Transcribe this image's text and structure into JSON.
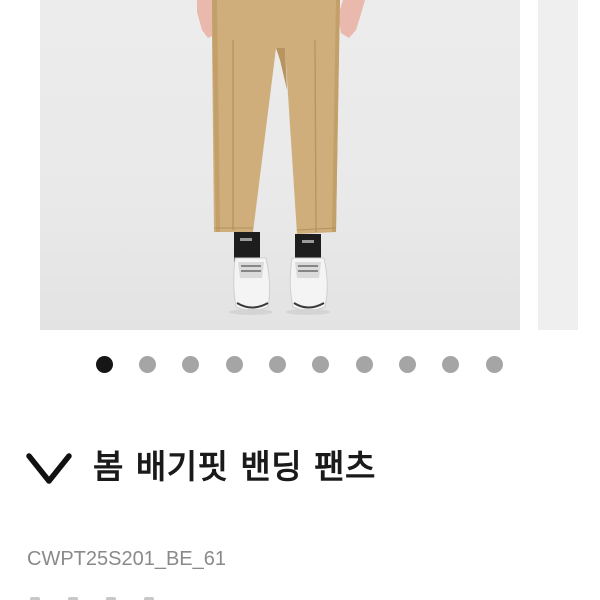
{
  "product": {
    "title": "봄 배기핏 밴딩 팬츠",
    "sku": "CWPT25S201_BE_61"
  },
  "carousel": {
    "total_images": 10,
    "active_index": 0
  },
  "icons": {
    "collapse": "chevron-down-icon"
  },
  "colors": {
    "pants": "#cfae7b",
    "dot_active": "#161616",
    "dot_inactive": "#a5a5a5",
    "title": "#1a1a1a",
    "sku": "#8a8a8a"
  }
}
